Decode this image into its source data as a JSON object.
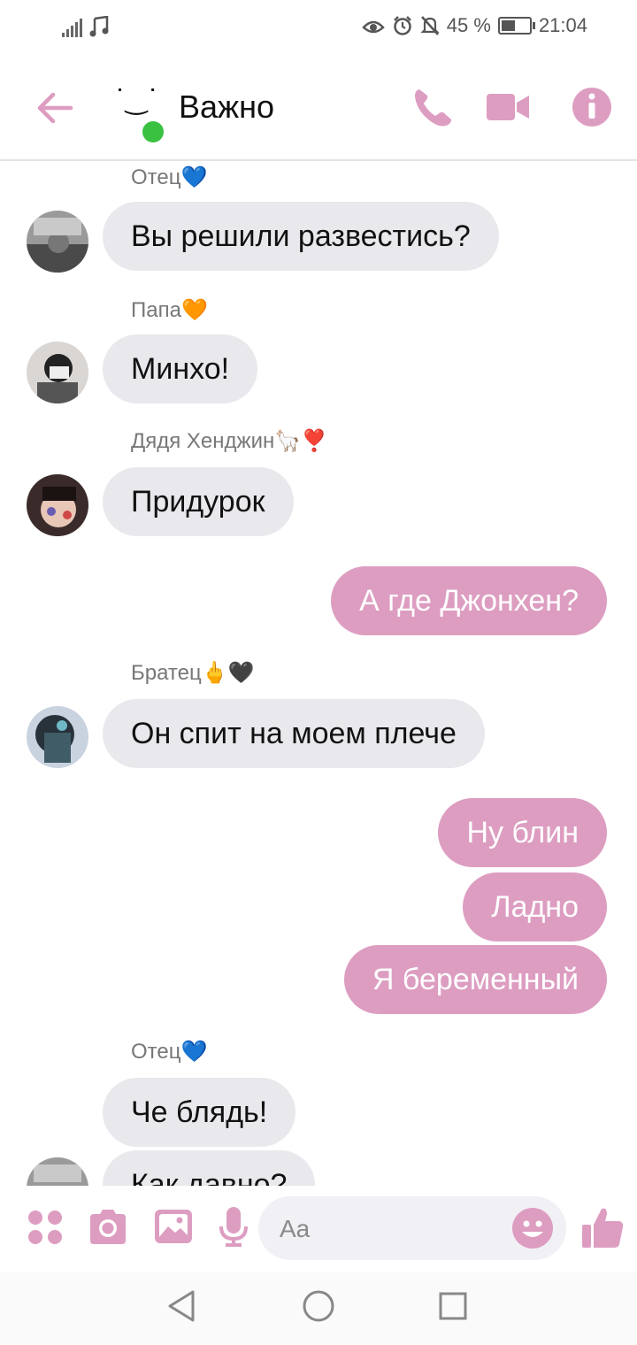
{
  "status_bar": {
    "battery": "45 %",
    "battery_level": 0.45,
    "time": "21:04",
    "icons": [
      "signal-icon",
      "music-note-icon",
      "eye-icon",
      "alarm-icon",
      "mute-bell-icon",
      "battery-icon"
    ]
  },
  "header": {
    "title": "Важно",
    "avatar_face": "˙‿˙",
    "online": true,
    "icons": [
      "back-arrow-icon",
      "phone-icon",
      "video-camera-icon",
      "info-icon"
    ]
  },
  "messages": [
    {
      "sender": "Отец💙",
      "text": "Вы решили развестись?",
      "side": "in"
    },
    {
      "sender": "Папа🧡",
      "text": "Минхо!",
      "side": "in"
    },
    {
      "sender": "Дядя Хенджин🦙❣️",
      "text": "Придурок",
      "side": "in"
    },
    {
      "text": "А где Джонхен?",
      "side": "out"
    },
    {
      "sender": "Братец🖕🖤",
      "text": "Он спит на моем плече",
      "side": "in"
    },
    {
      "text": "Ну блин",
      "side": "out"
    },
    {
      "text": "Ладно",
      "side": "out"
    },
    {
      "text": "Я беременный",
      "side": "out"
    },
    {
      "sender": "Отец💙",
      "text": "Че блядь!",
      "side": "in"
    },
    {
      "text": "Как давно?",
      "side": "in"
    }
  ],
  "composer": {
    "placeholder": "Aa",
    "icons": [
      "apps-grid-icon",
      "camera-icon",
      "gallery-icon",
      "microphone-icon",
      "emoji-icon",
      "thumbs-up-icon"
    ]
  },
  "nav_bar": {
    "icons": [
      "nav-back-icon",
      "nav-home-icon",
      "nav-recents-icon"
    ]
  },
  "colors": {
    "accent": "#dd9dc1",
    "incoming_bubble": "#e9e8ec",
    "online": "#3bc142"
  }
}
